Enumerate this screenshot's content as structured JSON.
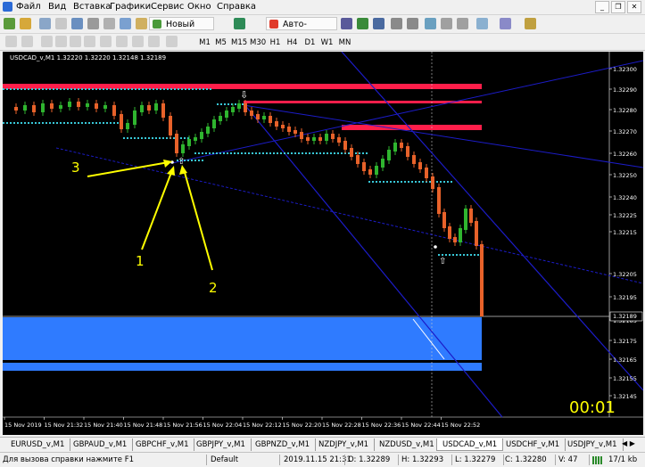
{
  "menu": [
    "Файл",
    "Вид",
    "Вставка",
    "Графики",
    "Сервис",
    "Окно",
    "Справка"
  ],
  "toolbar": {
    "new_order": "Новый ордер",
    "auto_trading": "Авто-торговля"
  },
  "timeframes": [
    "M1",
    "M5",
    "M15",
    "M30",
    "H1",
    "H4",
    "D1",
    "W1",
    "MN"
  ],
  "active_timeframe": "M1",
  "chart": {
    "title": "USDCAD_v,M1  1.32220 1.32220 1.32148 1.32189",
    "price_labels": [
      "1.32300",
      "1.32290",
      "1.32280",
      "1.32270",
      "1.32260",
      "1.32250",
      "1.32240",
      "1.32225",
      "1.32215",
      "1.32205",
      "1.32195",
      "1.32189",
      "1.32185",
      "1.32175",
      "1.32165",
      "1.32155",
      "1.32145"
    ],
    "current_price": "1.32189",
    "time_labels": [
      "15 Nov 2019",
      "15 Nov 21:32",
      "15 Nov 21:40",
      "15 Nov 21:48",
      "15 Nov 21:56",
      "15 Nov 22:04",
      "15 Nov 22:12",
      "15 Nov 22:20",
      "15 Nov 22:28",
      "15 Nov 22:36",
      "15 Nov 22:44",
      "15 Nov 22:52"
    ],
    "annotations": [
      "1",
      "2",
      "3"
    ],
    "countdown": "00:01",
    "colors": {
      "bull": "#2fb52f",
      "bear": "#e8622a",
      "resistance": "#ff1e4a",
      "zone": "#2f7bff",
      "trend": "#1c1cc8",
      "support_dots": "#38c8d8",
      "arrow": "#ffff00"
    }
  },
  "tabs": [
    "EURUSD_v,M1",
    "GBPAUD_v,M1",
    "GBPCHF_v,M1",
    "GBPJPY_v,M1",
    "GBPNZD_v,M1",
    "NZDJPY_v,M1",
    "NZDUSD_v,M1",
    "USDCAD_v,M1",
    "USDCHF_v,M1",
    "USDJPY_v,M1"
  ],
  "active_tab": "USDCAD_v,M1",
  "status": {
    "help": "Для вызова справки нажмите F1",
    "profile": "Default",
    "datetime": "2019.11.15 21:31",
    "open": "O: 1.32289",
    "high": "H: 1.32293",
    "low": "L: 1.32279",
    "close": "C: 1.32280",
    "volume": "V: 47",
    "traffic": "17/1 kb"
  }
}
